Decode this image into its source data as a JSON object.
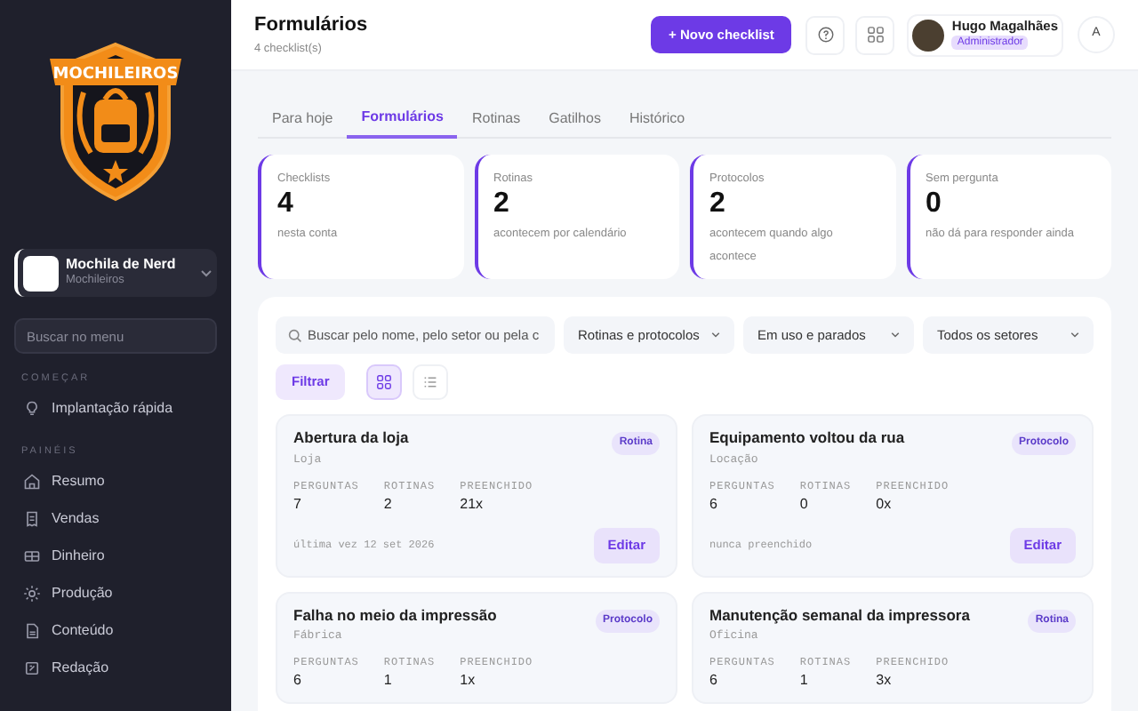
{
  "sidebar": {
    "logo_text": "MOCHILEIROS",
    "workspace": {
      "name": "Mochila de Nerd",
      "subtitle": "Mochileiros"
    },
    "search": {
      "placeholder": "Buscar no menu"
    },
    "sections": [
      {
        "title": "COMEÇAR",
        "items": [
          {
            "label": "Implantação rápida"
          }
        ]
      },
      {
        "title": "PAINÉIS",
        "items": [
          {
            "label": "Resumo"
          },
          {
            "label": "Vendas"
          },
          {
            "label": "Dinheiro"
          },
          {
            "label": "Produção"
          },
          {
            "label": "Conteúdo"
          },
          {
            "label": "Redação"
          }
        ]
      }
    ]
  },
  "header": {
    "title": "Formulários",
    "subtitle": "4 checklist(s)",
    "primary_button": "+ Novo checklist",
    "user": {
      "name": "Hugo Magalhães",
      "role": "Administrador",
      "initial": "A"
    }
  },
  "tabs": [
    {
      "label": "Para hoje",
      "selected": false
    },
    {
      "label": "Formulários",
      "selected": true
    },
    {
      "label": "Rotinas",
      "selected": false
    },
    {
      "label": "Gatilhos",
      "selected": false
    },
    {
      "label": "Histórico",
      "selected": false
    }
  ],
  "stats": [
    {
      "label": "Checklists",
      "value": "4",
      "caption": "nesta conta"
    },
    {
      "label": "Rotinas",
      "value": "2",
      "caption": "acontecem por calendário"
    },
    {
      "label": "Protocolos",
      "value": "2",
      "caption": "acontecem quando algo acontece"
    },
    {
      "label": "Sem pergunta",
      "value": "0",
      "caption": "não dá para responder ainda"
    }
  ],
  "filters": {
    "search_placeholder": "Buscar pelo nome, pelo setor ou pela c",
    "selects": [
      "Rotinas e protocolos",
      "Em uso e parados",
      "Todos os setores"
    ],
    "filter_button": "Filtrar",
    "views": [
      {
        "kind": "grid",
        "selected": true
      },
      {
        "kind": "list",
        "selected": false
      }
    ]
  },
  "cards": [
    {
      "title": "Abertura da loja",
      "sector": "Loja",
      "badge": "Rotina",
      "stats": [
        {
          "label": "PERGUNTAS",
          "value": "7"
        },
        {
          "label": "ROTINAS",
          "value": "2"
        },
        {
          "label": "PREENCHIDO",
          "value": "21x"
        }
      ],
      "footer": "última vez 12 set 2026",
      "button": "Editar"
    },
    {
      "title": "Equipamento voltou da rua",
      "sector": "Locação",
      "badge": "Protocolo",
      "stats": [
        {
          "label": "PERGUNTAS",
          "value": "6"
        },
        {
          "label": "ROTINAS",
          "value": "0"
        },
        {
          "label": "PREENCHIDO",
          "value": "0x"
        }
      ],
      "footer": "nunca preenchido",
      "button": "Editar"
    },
    {
      "title": "Falha no meio da impressão",
      "sector": "Fábrica",
      "badge": "Protocolo",
      "stats": [
        {
          "label": "PERGUNTAS",
          "value": "6"
        },
        {
          "label": "ROTINAS",
          "value": "1"
        },
        {
          "label": "PREENCHIDO",
          "value": "1x"
        }
      ]
    },
    {
      "title": "Manutenção semanal da impressora",
      "sector": "Oficina",
      "badge": "Rotina",
      "stats": [
        {
          "label": "PERGUNTAS",
          "value": "6"
        },
        {
          "label": "ROTINAS",
          "value": "1"
        },
        {
          "label": "PREENCHIDO",
          "value": "3x"
        }
      ]
    }
  ]
}
